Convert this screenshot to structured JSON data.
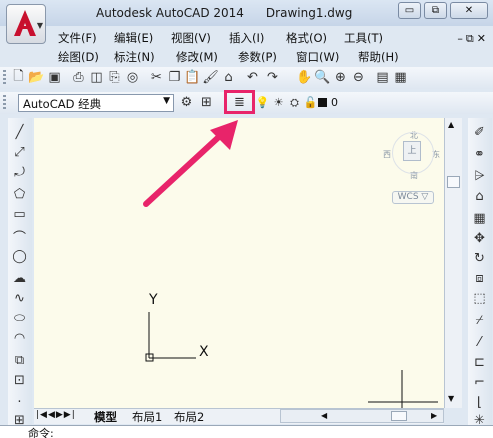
{
  "window": {
    "app_title": "Autodesk AutoCAD 2014",
    "document": "Drawing1.dwg",
    "minimize": "▭",
    "restore": "⧉",
    "close": "✕",
    "mdi_controls": "–⧉✕"
  },
  "menu_row1": [
    "文件(F)",
    "编辑(E)",
    "视图(V)",
    "插入(I)",
    "格式(O)",
    "工具(T)"
  ],
  "menu_row2": [
    "绘图(D)",
    "标注(N)",
    "修改(M)",
    "参数(P)",
    "窗口(W)",
    "帮助(H)"
  ],
  "workspace": {
    "value": "AutoCAD 经典"
  },
  "layer": {
    "current": "0"
  },
  "viewcube": {
    "north": "北",
    "south": "南",
    "east": "东",
    "west": "西",
    "face": "上",
    "wcs": "WCS ▽"
  },
  "ucs": {
    "y": "Y",
    "x": "X"
  },
  "layout_tabs": [
    "模型",
    "布局1",
    "布局2"
  ],
  "command": {
    "prompt": "命令:"
  },
  "icons": {
    "draw_toolbar": [
      "line-icon",
      "construction-line-icon",
      "polyline-icon",
      "polygon-icon",
      "rectangle-icon",
      "arc-icon",
      "circle-icon",
      "revision-cloud-icon",
      "spline-icon",
      "ellipse-icon",
      "ellipse-arc-icon",
      "insert-block-icon",
      "make-block-icon",
      "point-icon"
    ],
    "modify_toolbar": [
      "erase-icon",
      "copy-icon",
      "mirror-icon",
      "offset-icon",
      "array-icon",
      "move-icon",
      "rotate-icon",
      "scale-icon",
      "stretch-icon",
      "trim-icon",
      "extend-icon",
      "break-icon",
      "join-icon",
      "chamfer-icon"
    ]
  },
  "colors": {
    "highlight": "#e8246a",
    "canvas": "#fcfbeb",
    "arrow": "#e8246a"
  }
}
